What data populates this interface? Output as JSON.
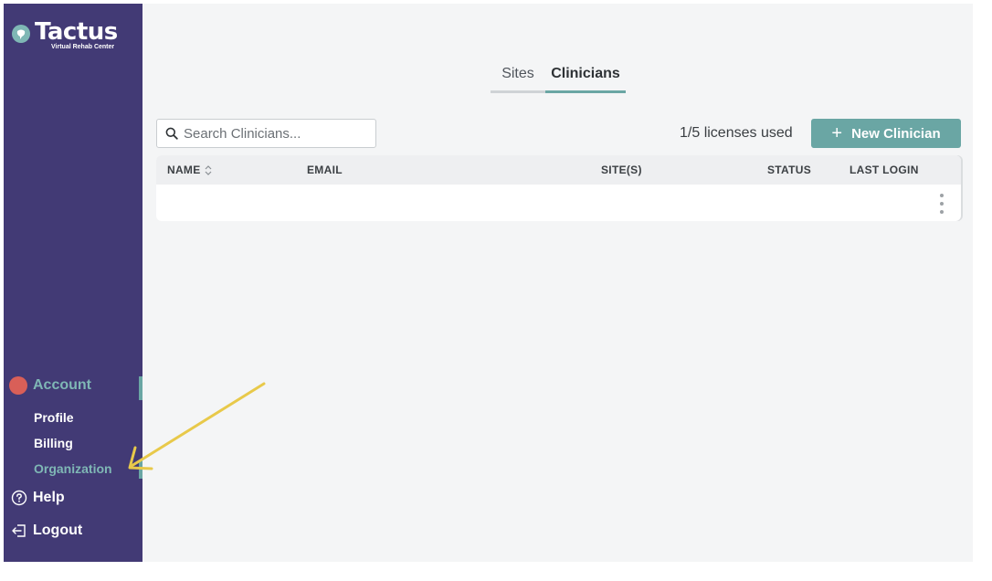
{
  "brand": {
    "name": "Tactus",
    "subtitle": "Virtual Rehab Center"
  },
  "sidebar": {
    "account_label": "Account",
    "items": [
      {
        "label": "Profile"
      },
      {
        "label": "Billing"
      },
      {
        "label": "Organization",
        "active": true
      }
    ],
    "help_label": "Help",
    "logout_label": "Logout"
  },
  "tabs": [
    {
      "label": "Sites",
      "active": false
    },
    {
      "label": "Clinicians",
      "active": true
    }
  ],
  "search": {
    "placeholder": "Search Clinicians..."
  },
  "licenses_text": "1/5 licenses used",
  "new_button_label": "New Clinician",
  "table": {
    "columns": [
      "NAME",
      "EMAIL",
      "SITE(S)",
      "STATUS",
      "LAST LOGIN"
    ],
    "rows": [
      {}
    ]
  },
  "colors": {
    "sidebar": "#423a75",
    "accent": "#6aa6a4",
    "avatar": "#d95f58",
    "annotation_arrow": "#e8c94a"
  },
  "icons": [
    "logo-icon",
    "search-icon",
    "sort-icon",
    "kebab-menu-icon",
    "help-icon",
    "logout-icon",
    "plus-icon"
  ]
}
